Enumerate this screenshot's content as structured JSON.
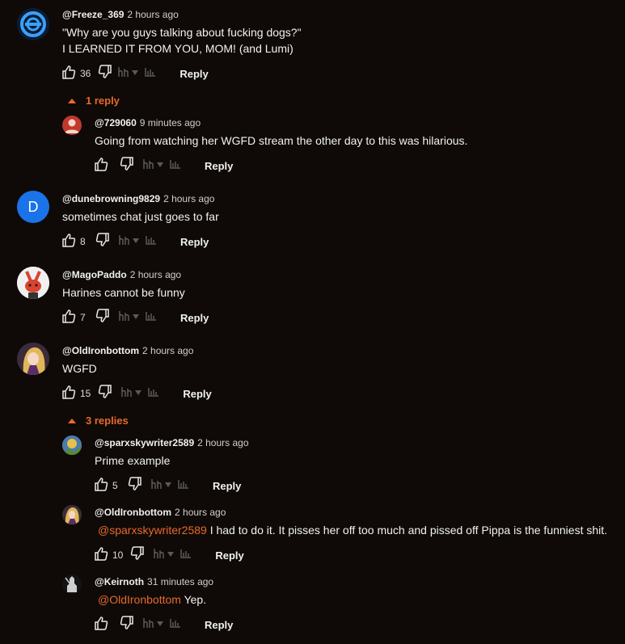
{
  "comments": [
    {
      "author": "@Freeze_369",
      "time": "2 hours ago",
      "lines": [
        "\"Why are you guys talking about fucking dogs?\"",
        "I LEARNED IT FROM YOU, MOM! (and Lumi)"
      ],
      "likes": "36",
      "reply": "Reply"
    },
    {
      "author": "@729060",
      "time": "9 minutes ago",
      "text": "Going from watching her WGFD stream  the other day to this was hilarious.",
      "reply": "Reply"
    },
    {
      "author": "@dunebrowning9829",
      "time": "2 hours ago",
      "text": "sometimes chat just goes to far",
      "likes": "8",
      "reply": "Reply",
      "avatar_letter": "D"
    },
    {
      "author": "@MagoPaddo",
      "time": "2 hours ago",
      "text": "Harines cannot be funny",
      "likes": "7",
      "reply": "Reply"
    },
    {
      "author": "@OldIronbottom",
      "time": "2 hours ago",
      "text": "WGFD",
      "likes": "15",
      "reply": "Reply"
    },
    {
      "author": "@sparxskywriter2589",
      "time": "2 hours ago",
      "text": "Prime example",
      "likes": "5",
      "reply": "Reply"
    },
    {
      "author": "@OldIronbottom",
      "time": "2 hours ago",
      "mention": "@sparxskywriter2589",
      "text": "I had to do it. It pisses her off too much and pissed off Pippa is the funniest shit.",
      "likes": "10",
      "reply": "Reply"
    },
    {
      "author": "@Keirnoth",
      "time": "31 minutes ago",
      "mention": "@OldIronbottom",
      "text": "Yep.",
      "reply": "Reply"
    }
  ],
  "reply_toggles": [
    "1 reply",
    "3 replies"
  ],
  "icons": {
    "like": "thumbs-up-icon",
    "dislike": "thumbs-down-icon",
    "hype": "hype-icon",
    "more": "dropdown-arrow-icon",
    "stats": "stats-icon"
  },
  "colors": {
    "background": "#0f0a07",
    "accent": "#e8692c",
    "avatar_d": "#1a73e8"
  }
}
